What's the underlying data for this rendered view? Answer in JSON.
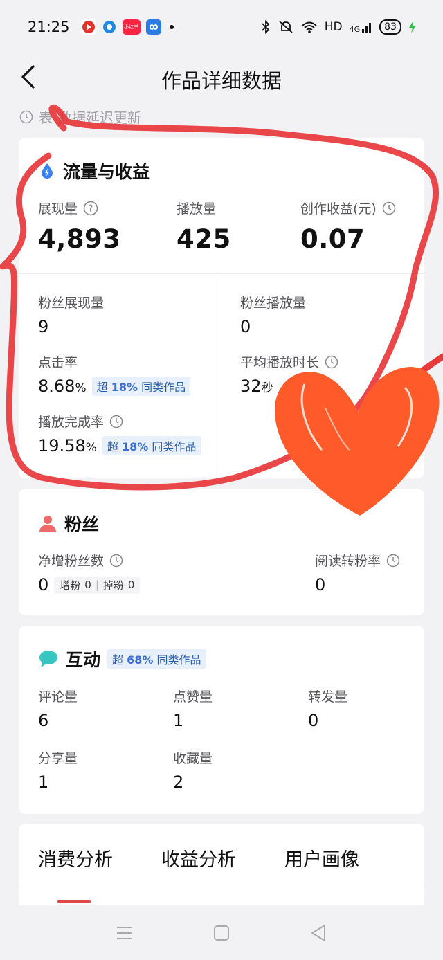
{
  "status_bar": {
    "time": "21:25",
    "network": "HD",
    "signal": "4G",
    "battery": "83",
    "app_icons": [
      "youtube-like-app-icon",
      "circle-app-icon",
      "xiaohongshu-app-icon",
      "infinity-app-icon"
    ],
    "app_icon_text": "小红书"
  },
  "header": {
    "title": "作品详细数据"
  },
  "delay_note": "表  数据延迟更新",
  "traffic": {
    "title": "流量与收益",
    "exposure": {
      "label": "展现量",
      "value": "4,893"
    },
    "plays": {
      "label": "播放量",
      "value": "425"
    },
    "income": {
      "label": "创作收益(元)",
      "value": "0.07"
    },
    "fan_exposure": {
      "label": "粉丝展现量",
      "value": "9"
    },
    "fan_plays": {
      "label": "粉丝播放量",
      "value": "0"
    },
    "ctr": {
      "label": "点击率",
      "value": "8.68",
      "unit": "%",
      "badge_prefix": "超",
      "badge_pct": "18%",
      "badge_suffix": "同类作品"
    },
    "avg_duration": {
      "label": "平均播放时长",
      "value": "32",
      "unit": "秒"
    },
    "completion": {
      "label": "播放完成率",
      "value": "19.58",
      "unit": "%",
      "badge_prefix": "超",
      "badge_pct": "18%",
      "badge_suffix": "同类作品"
    }
  },
  "fans": {
    "title": "粉丝",
    "net_gain": {
      "label": "净增粉丝数",
      "value": "0",
      "gain_label": "增粉",
      "gain_value": "0",
      "loss_label": "掉粉",
      "loss_value": "0"
    },
    "conversion": {
      "label": "阅读转粉率",
      "value": "0"
    }
  },
  "interaction": {
    "title": "互动",
    "badge_prefix": "超",
    "badge_pct": "68%",
    "badge_suffix": "同类作品",
    "comments": {
      "label": "评论量",
      "value": "6"
    },
    "likes": {
      "label": "点赞量",
      "value": "1"
    },
    "reposts": {
      "label": "转发量",
      "value": "0"
    },
    "shares": {
      "label": "分享量",
      "value": "1"
    },
    "favorites": {
      "label": "收藏量",
      "value": "2"
    }
  },
  "tabs": [
    "消费分析",
    "收益分析",
    "用户画像"
  ],
  "colors": {
    "accent_red": "#e04848",
    "badge_bg": "#e8f0fb",
    "badge_text": "#2a5da8",
    "scribble": "#e8393c",
    "heart": "#ff5a2a"
  }
}
